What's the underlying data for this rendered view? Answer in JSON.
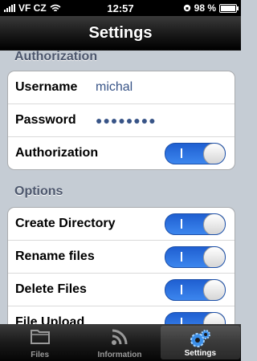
{
  "status": {
    "carrier": "VF CZ",
    "time": "12:57",
    "battery_percent": "98 %",
    "battery_level": 0.98
  },
  "nav": {
    "title": "Settings"
  },
  "sections": [
    {
      "header": "Authorization",
      "rows": [
        {
          "label": "Username",
          "value": "michal"
        },
        {
          "label": "Password",
          "value": "●●●●●●●●"
        },
        {
          "label": "Authorization",
          "toggle": true
        }
      ]
    },
    {
      "header": "Options",
      "rows": [
        {
          "label": "Create Directory",
          "toggle": true
        },
        {
          "label": "Rename files",
          "toggle": true
        },
        {
          "label": "Delete Files",
          "toggle": true
        },
        {
          "label": "File Upload",
          "toggle": true
        }
      ]
    }
  ],
  "tabs": [
    {
      "label": "Files",
      "icon": "folder-icon",
      "selected": false
    },
    {
      "label": "Information",
      "icon": "rss-icon",
      "selected": false
    },
    {
      "label": "Settings",
      "icon": "gears-icon",
      "selected": true
    }
  ],
  "colors": {
    "background": "#c5ccd4",
    "toggle_on": "#2b73e6",
    "value_text": "#385487"
  }
}
